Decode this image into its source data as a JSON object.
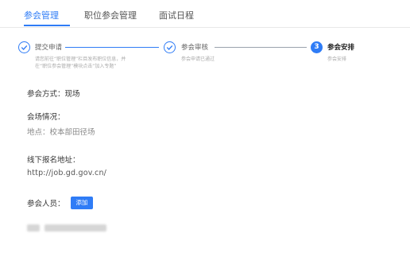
{
  "tabs": [
    {
      "label": "参会管理",
      "active": true
    },
    {
      "label": "职位参会管理",
      "active": false
    },
    {
      "label": "面试日程",
      "active": false
    }
  ],
  "steps": [
    {
      "title": "提交申请",
      "desc_lines": [
        "请您前往“职位管理”栏目发布职位信息，并",
        "在“职位参会管理”模块点击“加入专题”"
      ],
      "icon": "check-icon",
      "status": "done"
    },
    {
      "title": "参会审核",
      "desc_lines": [
        "参会申请已通过"
      ],
      "icon": "check-icon",
      "status": "done"
    },
    {
      "title": "参会安排",
      "desc_lines": [
        "参会安排"
      ],
      "number": "3",
      "status": "current"
    }
  ],
  "form": {
    "method_label": "参会方式：",
    "method_value": "现场",
    "venue_label": "会场情况：",
    "venue_value": "地点：校本部田径场",
    "offline_label": "线下报名地址：",
    "offline_url": "http://job.gd.gov.cn/",
    "attendees_label": "参会人员：",
    "add_button": "添加"
  },
  "colors": {
    "accent": "#2f7cf6"
  }
}
